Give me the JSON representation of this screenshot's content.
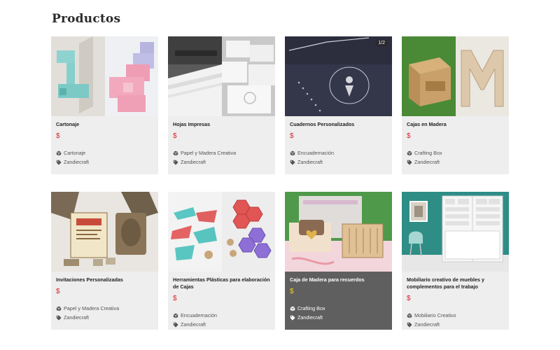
{
  "page_title": "Productos",
  "colors": {
    "price": "#d6272c",
    "price_highlight": "#f4d40b",
    "card_bg": "#eeeeee",
    "card_highlight_bg": "#5f5f5f"
  },
  "icons": {
    "category": "cube-icon",
    "tag": "tag-icon"
  },
  "products": [
    {
      "title": "Cartonaje",
      "price": "$",
      "category": "Cartonaje",
      "tag": "Zandiecraft"
    },
    {
      "title": "Hojas Impresas",
      "price": "$",
      "category": "Papel y Madera Creativa",
      "tag": "Zandiecraft"
    },
    {
      "title": "Cuadernos Personalizados",
      "price": "$",
      "category": "Encuadernación",
      "tag": "Zandiecraft",
      "badge": "1/2"
    },
    {
      "title": "Cajas en Madera",
      "price": "$",
      "category": "Crafting Box",
      "tag": "Zandiecraft"
    },
    {
      "title": "Invitaciones Personalizadas",
      "price": "$",
      "category": "Papel y Madera Creativa",
      "tag": "Zandiecraft"
    },
    {
      "title": "Herramientas Plásticas para elaboración de Cajas",
      "price": "$",
      "category": "Encuadernación",
      "tag": "Zandiecraft"
    },
    {
      "title": "Caja de Madera para recuerdos",
      "price": "$",
      "category": "Crafting Box",
      "tag": "Zandiecraft"
    },
    {
      "title": "Mobiliario creativo de muebles y complementos para el trabajo",
      "price": "$",
      "category": "Mobiliario Creativo",
      "tag": "Zandiecraft"
    }
  ]
}
